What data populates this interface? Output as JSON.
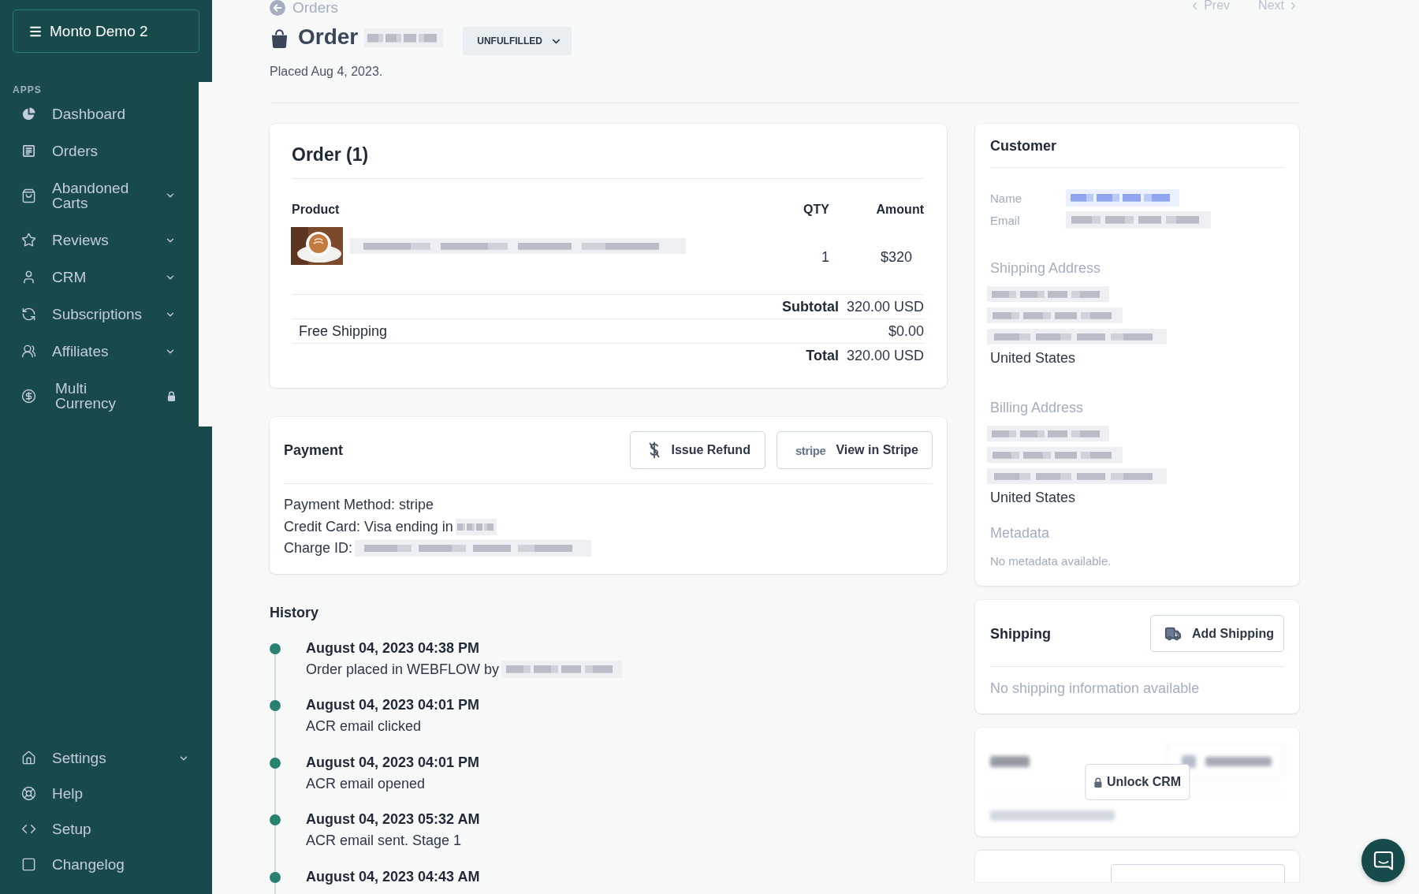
{
  "sidebar": {
    "workspace": "Monto Demo 2",
    "section_label": "APPS",
    "items": [
      {
        "label": "Dashboard",
        "kind": "link"
      },
      {
        "label": "Orders",
        "kind": "link"
      },
      {
        "label": "Abandoned Carts",
        "kind": "menu"
      },
      {
        "label": "Reviews",
        "kind": "menu"
      },
      {
        "label": "CRM",
        "kind": "menu"
      },
      {
        "label": "Subscriptions",
        "kind": "menu"
      },
      {
        "label": "Affiliates",
        "kind": "menu"
      },
      {
        "label": "Multi Currency",
        "kind": "locked"
      }
    ],
    "footer_items": [
      {
        "label": "Settings",
        "kind": "menu"
      },
      {
        "label": "Help",
        "kind": "link"
      },
      {
        "label": "Setup",
        "kind": "link"
      },
      {
        "label": "Changelog",
        "kind": "link"
      }
    ]
  },
  "header": {
    "back_link": "Orders",
    "pager": [
      {
        "label": "Prev",
        "kind": "prev"
      },
      {
        "label": "Next",
        "kind": "next"
      }
    ],
    "title": "Order",
    "status": "UNFULFILLED",
    "placed": "Placed Aug 4, 2023."
  },
  "order_card": {
    "title": "Order (1)",
    "columns": [
      "Product",
      "QTY",
      "Amount"
    ],
    "items": [
      {
        "qty": "1",
        "amount": "$320"
      }
    ],
    "totals": [
      {
        "label": "Subtotal",
        "value": "320.00 USD",
        "kind": "summary"
      },
      {
        "label": "Free Shipping",
        "value": "$0.00",
        "kind": "line"
      },
      {
        "label": "Total",
        "value": "320.00 USD",
        "kind": "summary"
      }
    ]
  },
  "payment": {
    "title": "Payment",
    "actions": [
      {
        "label": "Issue Refund",
        "kind": "refund"
      },
      {
        "label": "View in Stripe",
        "kind": "stripe",
        "logo": "stripe"
      }
    ],
    "lines": [
      {
        "text": "Payment Method: stripe",
        "redacted": false
      },
      {
        "text": "Credit Card: Visa ending in",
        "redacted": true
      },
      {
        "text": "Charge ID:",
        "redacted": true
      }
    ]
  },
  "history": {
    "title": "History",
    "events": [
      {
        "time": "August 04, 2023 04:38 PM",
        "text": "Order placed in WEBFLOW by",
        "redacted": true
      },
      {
        "time": "August 04, 2023 04:01 PM",
        "text": "ACR email clicked",
        "redacted": false
      },
      {
        "time": "August 04, 2023 04:01 PM",
        "text": "ACR email opened",
        "redacted": false
      },
      {
        "time": "August 04, 2023 05:32 AM",
        "text": "ACR email sent. Stage 1",
        "redacted": false
      },
      {
        "time": "August 04, 2023 04:43 AM"
      }
    ]
  },
  "customer": {
    "title": "Customer",
    "fields": [
      {
        "label": "Name",
        "kind": "link"
      },
      {
        "label": "Email",
        "kind": "text"
      }
    ],
    "addresses": [
      {
        "title": "Shipping Address",
        "country": "United States"
      },
      {
        "title": "Billing Address",
        "country": "United States"
      }
    ],
    "metadata": {
      "title": "Metadata",
      "empty": "No metadata available."
    }
  },
  "shipping": {
    "title": "Shipping",
    "action": "Add Shipping",
    "empty": "No shipping information available"
  },
  "notes": {
    "locked": true,
    "unlock_action": "Unlock CRM"
  }
}
